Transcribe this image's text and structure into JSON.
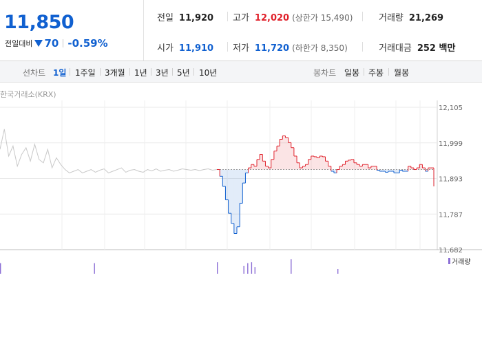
{
  "price": {
    "current": "11,850",
    "change_label": "전일대비",
    "change_value": "70",
    "change_pct": "-0.59%"
  },
  "stats": {
    "prev_close": {
      "label": "전일",
      "value": "11,920"
    },
    "high": {
      "label": "고가",
      "value": "12,020",
      "sub": "(상한가 15,490)"
    },
    "volume": {
      "label": "거래량",
      "value": "21,269"
    },
    "open": {
      "label": "시가",
      "value": "11,910"
    },
    "low": {
      "label": "저가",
      "value": "11,720",
      "sub": "(하한가 8,350)"
    },
    "amount": {
      "label": "거래대금",
      "value": "252 백만"
    }
  },
  "period_bar": {
    "line_label": "선차트",
    "line_periods": [
      "1일",
      "1주일",
      "3개월",
      "1년",
      "3년",
      "5년",
      "10년"
    ],
    "active_period": "1일",
    "candle_label": "봉차트",
    "candle_periods": [
      "일봉",
      "주봉",
      "월봉"
    ]
  },
  "chart_data": {
    "type": "line",
    "source_label": "한국거래소(KRX)",
    "y_ticks": [
      "12,105",
      "11,999",
      "11,893",
      "11,787",
      "11,682"
    ],
    "ylim": [
      11682,
      12105
    ],
    "baseline": 11920,
    "colors": {
      "pre_open": "#c8c8c8",
      "above": "#e0202a",
      "below": "#1060d0",
      "volume": "#8c6fd6"
    },
    "pre_open_series": [
      11980,
      12040,
      11960,
      11990,
      11930,
      11965,
      11985,
      11945,
      11995,
      11950,
      11940,
      11980,
      11925,
      11955,
      11935,
      11920,
      11910,
      11915,
      11920,
      11910,
      11915,
      11920,
      11912,
      11918,
      11922,
      11910,
      11915,
      11920,
      11925,
      11912,
      11918,
      11920,
      11915,
      11912,
      11920,
      11916,
      11922,
      11915,
      11918,
      11920,
      11915,
      11918,
      11922,
      11920,
      11918,
      11920,
      11917,
      11920,
      11922,
      11918,
      11920
    ],
    "session_series": [
      11920,
      11900,
      11870,
      11830,
      11790,
      11760,
      11730,
      11750,
      11820,
      11880,
      11910,
      11925,
      11935,
      11930,
      11950,
      11965,
      11945,
      11930,
      11925,
      11950,
      11975,
      11990,
      12010,
      12020,
      12015,
      12000,
      11985,
      11960,
      11940,
      11925,
      11930,
      11935,
      11950,
      11960,
      11958,
      11955,
      11960,
      11958,
      11945,
      11930,
      11915,
      11910,
      11920,
      11930,
      11935,
      11945,
      11948,
      11950,
      11940,
      11935,
      11930,
      11935,
      11935,
      11925,
      11930,
      11930,
      11918,
      11915,
      11915,
      11912,
      11915,
      11915,
      11910,
      11910,
      11918,
      11915,
      11915,
      11930,
      11925,
      11920,
      11925,
      11935,
      11925,
      11915,
      11925,
      11925,
      11870
    ],
    "volume_label": "거래량",
    "volume_bars": [
      {
        "pos": 0.0,
        "v": 0.55
      },
      {
        "pos": 0.195,
        "v": 0.55
      },
      {
        "pos": 0.45,
        "v": 0.6
      },
      {
        "pos": 0.505,
        "v": 0.4
      },
      {
        "pos": 0.513,
        "v": 0.55
      },
      {
        "pos": 0.521,
        "v": 0.6
      },
      {
        "pos": 0.528,
        "v": 0.35
      },
      {
        "pos": 0.603,
        "v": 0.75
      },
      {
        "pos": 0.7,
        "v": 0.25
      }
    ]
  }
}
